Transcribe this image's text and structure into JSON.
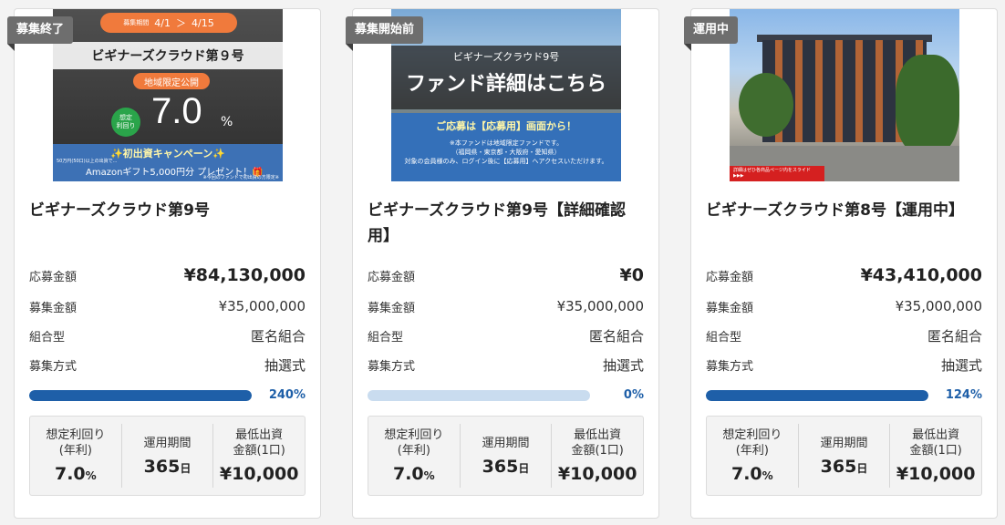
{
  "cards": [
    {
      "badge": "募集終了",
      "title": "ビギナーズクラウド第9号",
      "rows": [
        {
          "label": "応募金額",
          "value": "¥84,130,000"
        },
        {
          "label": "募集金額",
          "value": "¥35,000,000"
        },
        {
          "label": "組合型",
          "value": "匿名組合"
        },
        {
          "label": "募集方式",
          "value": "抽選式"
        }
      ],
      "progress": {
        "percent_label": "240%",
        "fill_fraction": 1.0
      },
      "stats": [
        {
          "label": "想定利回り\n(年利)",
          "value": "7.0",
          "unit": "%"
        },
        {
          "label": "運用期間",
          "value": "365",
          "unit": "日"
        },
        {
          "label": "最低出資\n金額(1口)",
          "value": "¥10,000",
          "unit": ""
        }
      ],
      "image": {
        "period_label": "募集期間",
        "period_from": "4/1",
        "period_arrow": "＞",
        "period_to": "4/15",
        "banner": "ビギナーズクラウド第９号",
        "limited": "地域限定公開",
        "yield_badge_1": "想定",
        "yield_badge_2": "利回り",
        "yield_value": "7.0",
        "yield_unit": "%",
        "campaign_title": "✨初出資キャンペーン✨",
        "campaign_note": "50万円(50口)以上の出資で...",
        "campaign_gift": "Amazonギフト5,000円分 プレゼント！🎁",
        "campaign_fine": "※今回のファンドで初出資の方限定※"
      }
    },
    {
      "badge": "募集開始前",
      "title": "ビギナーズクラウド第9号【詳細確認用】",
      "rows": [
        {
          "label": "応募金額",
          "value": "¥0"
        },
        {
          "label": "募集金額",
          "value": "¥35,000,000"
        },
        {
          "label": "組合型",
          "value": "匿名組合"
        },
        {
          "label": "募集方式",
          "value": "抽選式"
        }
      ],
      "progress": {
        "percent_label": "0%",
        "fill_fraction": 0.0
      },
      "stats": [
        {
          "label": "想定利回り\n(年利)",
          "value": "7.0",
          "unit": "%"
        },
        {
          "label": "運用期間",
          "value": "365",
          "unit": "日"
        },
        {
          "label": "最低出資\n金額(1口)",
          "value": "¥10,000",
          "unit": ""
        }
      ],
      "image": {
        "sub": "ビギナーズクラウド9号",
        "headline": "ファンド詳細はこちら",
        "notice": "ご応募は【応募用】画面から！",
        "fine1": "※本ファンドは地域限定ファンドです。",
        "fine2": "（福岡県・東京都・大阪府・愛知県）",
        "fine3": "対象の会員様のみ、ログイン後に【応募用】へアクセスいただけます。"
      }
    },
    {
      "badge": "運用中",
      "title": "ビギナーズクラウド第8号【運用中】",
      "rows": [
        {
          "label": "応募金額",
          "value": "¥43,410,000"
        },
        {
          "label": "募集金額",
          "value": "¥35,000,000"
        },
        {
          "label": "組合型",
          "value": "匿名組合"
        },
        {
          "label": "募集方式",
          "value": "抽選式"
        }
      ],
      "progress": {
        "percent_label": "124%",
        "fill_fraction": 1.0
      },
      "stats": [
        {
          "label": "想定利回り\n(年利)",
          "value": "7.0",
          "unit": "%"
        },
        {
          "label": "運用期間",
          "value": "365",
          "unit": "日"
        },
        {
          "label": "最低出資\n金額(1口)",
          "value": "¥10,000",
          "unit": ""
        }
      ],
      "image": {
        "tag": "詳細はぜひ各商品ページ内をスライド ▶▶▶"
      }
    }
  ]
}
